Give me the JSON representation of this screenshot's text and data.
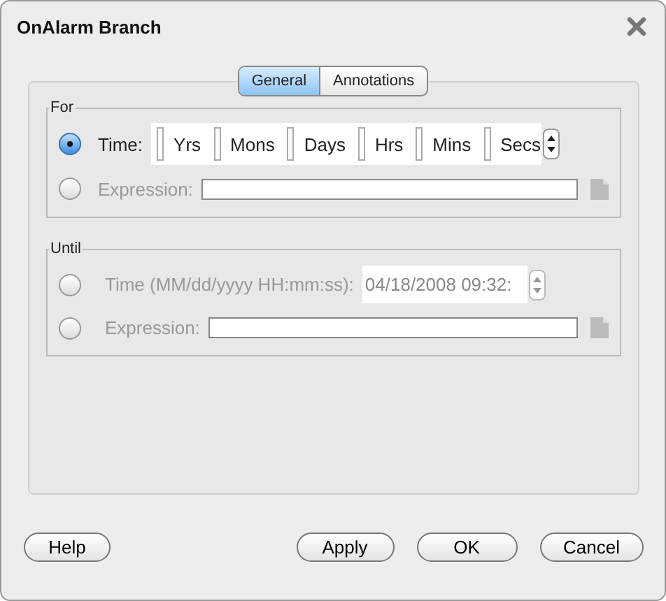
{
  "window": {
    "title": "OnAlarm Branch"
  },
  "tabs": [
    {
      "label": "General",
      "selected": true
    },
    {
      "label": "Annotations",
      "selected": false
    }
  ],
  "groups": [
    {
      "legend": "For",
      "rows": [
        {
          "kind": "units",
          "label": "Time:",
          "selected": true,
          "disabled": false,
          "units": [
            "Yrs",
            "Mons",
            "Days",
            "Hrs",
            "Mins",
            "Secs"
          ]
        },
        {
          "kind": "expression",
          "label": "Expression:",
          "selected": false,
          "disabled": true
        }
      ]
    },
    {
      "legend": "Until",
      "rows": [
        {
          "kind": "datetime",
          "label": "Time (MM/dd/yyyy HH:mm:ss):",
          "selected": false,
          "disabled": true,
          "value": "04/18/2008 09:32:"
        },
        {
          "kind": "expression",
          "label": "Expression:",
          "selected": false,
          "disabled": true
        }
      ]
    }
  ],
  "buttons_left": [
    "Help"
  ],
  "buttons_right": [
    "Apply",
    "OK",
    "Cancel"
  ]
}
